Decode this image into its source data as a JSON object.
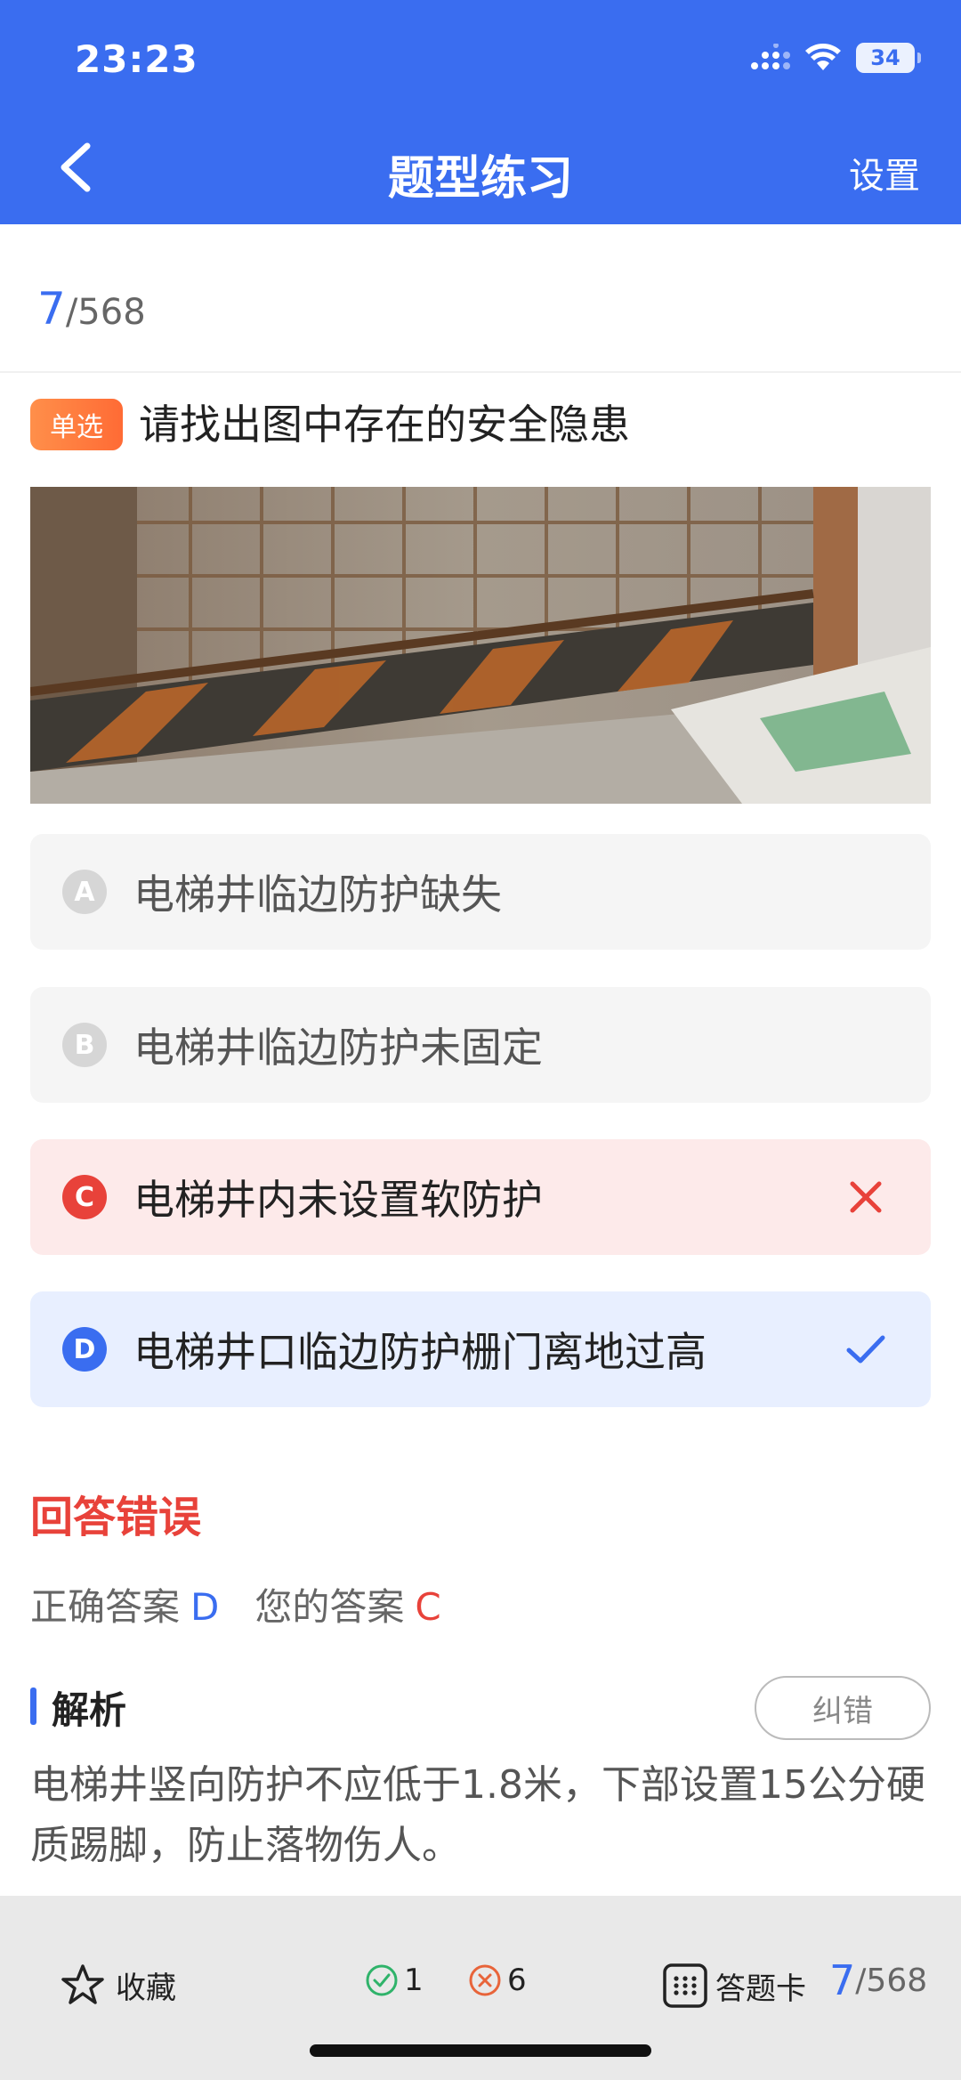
{
  "status": {
    "time": "23:23",
    "battery": "34"
  },
  "nav": {
    "title": "题型练习",
    "settings": "设置"
  },
  "progress": {
    "current": "7",
    "total": "/568"
  },
  "question": {
    "type_badge": "单选",
    "text": "请找出图中存在的安全隐患"
  },
  "options": [
    {
      "letter": "A",
      "text": "电梯井临边防护缺失"
    },
    {
      "letter": "B",
      "text": "电梯井临边防护未固定"
    },
    {
      "letter": "C",
      "text": "电梯井内未设置软防护"
    },
    {
      "letter": "D",
      "text": "电梯井口临边防护栅门离地过高"
    }
  ],
  "result": {
    "title": "回答错误",
    "correct_label": "正确答案",
    "correct_value": "D",
    "user_label": "您的答案",
    "user_value": "C"
  },
  "analysis": {
    "title": "解析",
    "correction_button": "纠错",
    "text": "电梯井竖向防护不应低于1.8米，下部设置15公分硬质踢脚，防止落物伤人。"
  },
  "bottom_bar": {
    "favorite": "收藏",
    "correct_count": "1",
    "wrong_count": "6",
    "answer_card": "答题卡",
    "current": "7",
    "total": "/568"
  },
  "colors": {
    "primary": "#3a6df0",
    "error": "#e8423a",
    "success": "#2fb36a"
  }
}
